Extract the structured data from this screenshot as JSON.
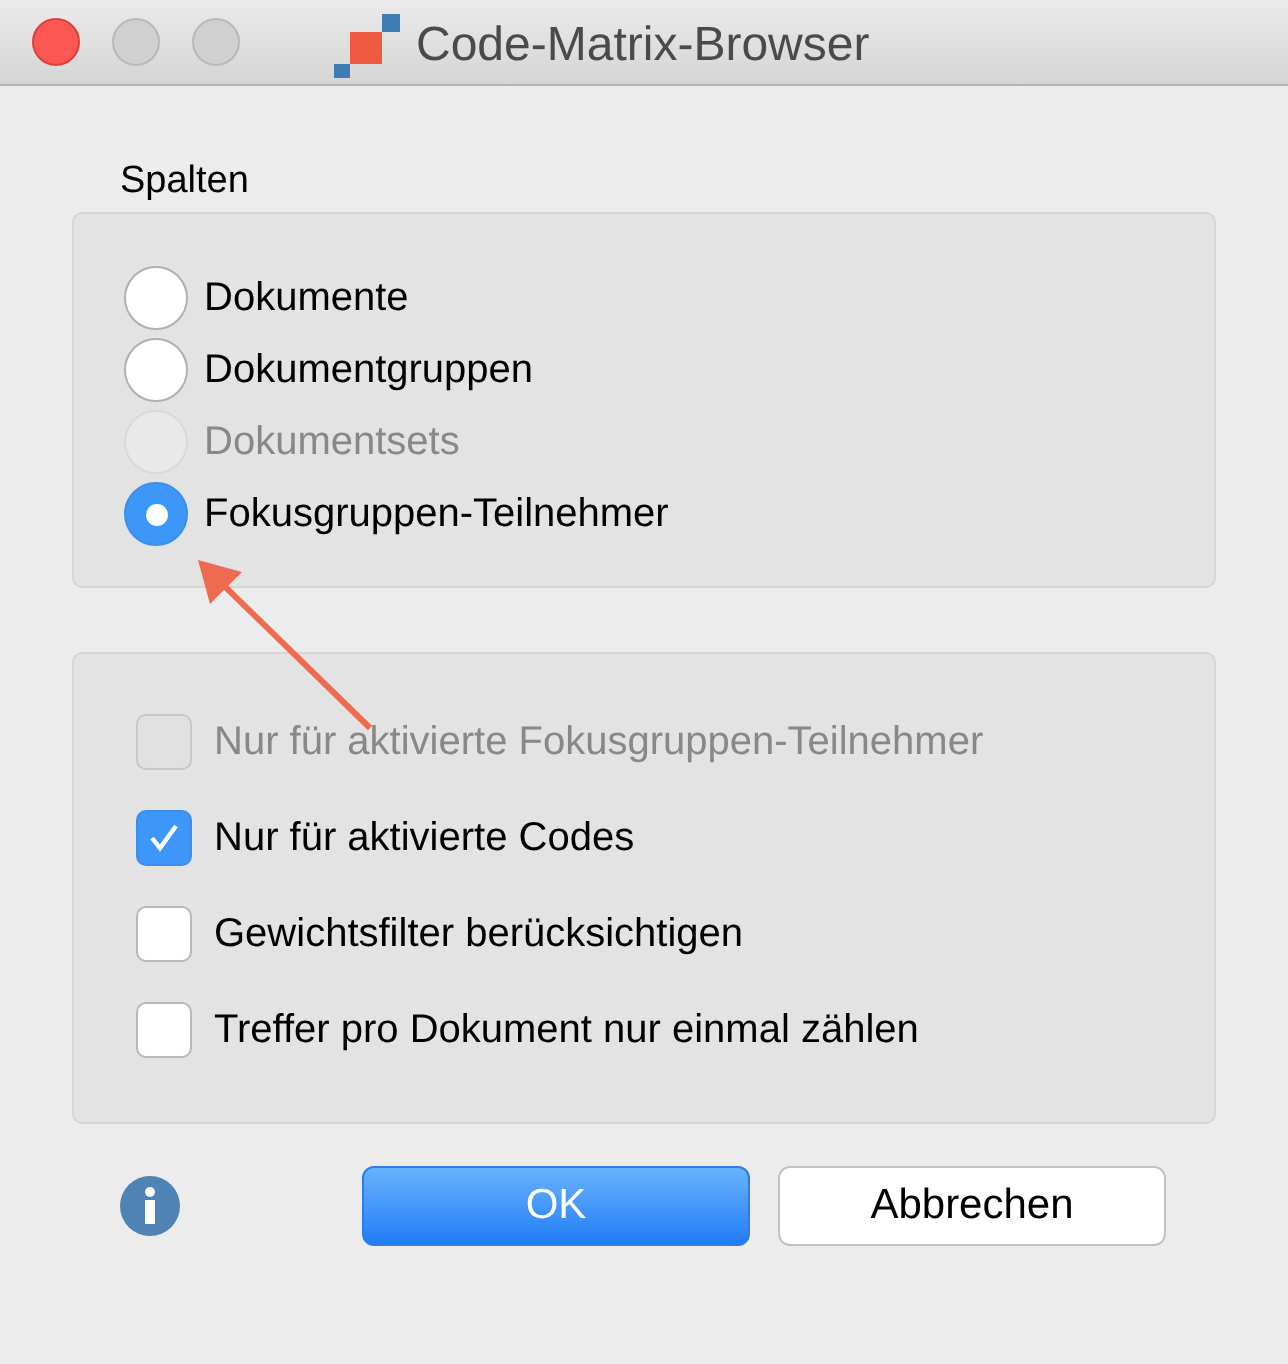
{
  "window": {
    "title": "Code-Matrix-Browser"
  },
  "columns": {
    "label": "Spalten",
    "options": [
      {
        "label": "Dokumente",
        "selected": false,
        "disabled": false
      },
      {
        "label": "Dokumentgruppen",
        "selected": false,
        "disabled": false
      },
      {
        "label": "Dokumentsets",
        "selected": false,
        "disabled": true
      },
      {
        "label": "Fokusgruppen-Teilnehmer",
        "selected": true,
        "disabled": false
      }
    ]
  },
  "filters": [
    {
      "label": "Nur für aktivierte Fokusgruppen-Teilnehmer",
      "checked": false,
      "disabled": true
    },
    {
      "label": "Nur für aktivierte Codes",
      "checked": true,
      "disabled": false
    },
    {
      "label": "Gewichtsfilter berücksichtigen",
      "checked": false,
      "disabled": false
    },
    {
      "label": "Treffer pro Dokument nur einmal zählen",
      "checked": false,
      "disabled": false
    }
  ],
  "buttons": [
    {
      "label": "OK",
      "kind": "primary"
    },
    {
      "label": "Abbrechen",
      "kind": "secondary"
    }
  ]
}
